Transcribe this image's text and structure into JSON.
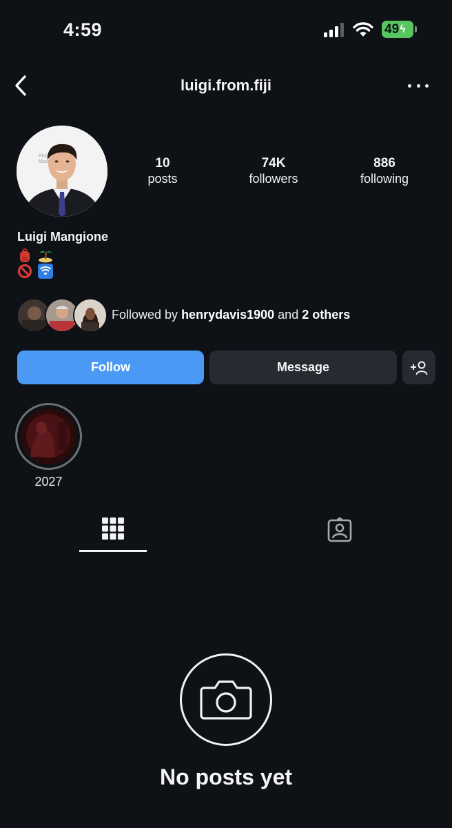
{
  "status_bar": {
    "time": "4:59",
    "battery": "49",
    "icons": [
      "signal-icon",
      "wifi-icon",
      "battery-icon"
    ]
  },
  "header": {
    "username": "luigi.from.fiji",
    "back_icon": "chevron-left-icon",
    "more_icon": "ellipsis-icon"
  },
  "profile": {
    "display_name": "Luigi Mangione",
    "bio_line1_emojis": [
      "backpack",
      "desert-island"
    ],
    "bio_line2_emojis": [
      "prohibited",
      "wifi-signal"
    ],
    "stats": [
      {
        "value": "10",
        "label": "posts"
      },
      {
        "value": "74K",
        "label": "followers"
      },
      {
        "value": "886",
        "label": "following"
      }
    ]
  },
  "followed_by": {
    "prefix": "Followed by",
    "user": "henrydavis1900",
    "joiner": "and",
    "others": "2 others"
  },
  "actions": {
    "follow": "Follow",
    "message": "Message",
    "add_icon": "add-person-icon"
  },
  "highlights": [
    {
      "label": "2027"
    }
  ],
  "tabs": [
    {
      "name": "posts-grid",
      "icon": "grid-icon",
      "active": true
    },
    {
      "name": "tagged",
      "icon": "tagged-person-icon",
      "active": false
    }
  ],
  "empty_state": {
    "icon": "camera-icon",
    "message": "No posts yet"
  },
  "colors": {
    "background": "#0e1116",
    "follow_button": "#4a9af5",
    "secondary_button": "#262a31",
    "battery": "#55c75e"
  }
}
